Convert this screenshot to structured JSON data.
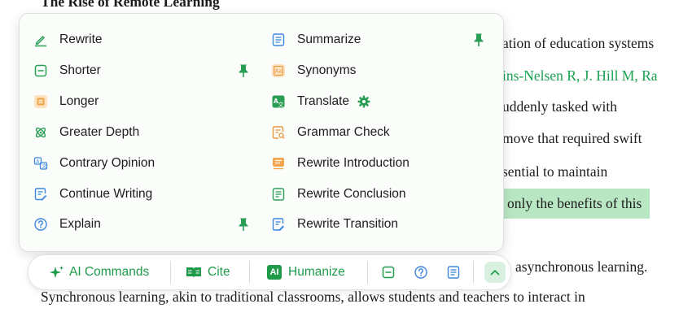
{
  "document": {
    "title": "The Rise of Remote Learning",
    "line1": "ation of education systems",
    "line2": "ins-Nelsen R, J. Hill M, Ra",
    "line3": "uddenly tasked with",
    "line4": "move that required swift",
    "line5": "sential to maintain",
    "line6": "only the benefits of this",
    "line7": "asynchronous learning.",
    "line8": "Synchronous learning, akin to traditional classrooms, allows students and teachers to interact in"
  },
  "menu": {
    "left": [
      {
        "label": "Rewrite",
        "icon": "pencil-icon",
        "pinned": false
      },
      {
        "label": "Shorter",
        "icon": "shorter-icon",
        "pinned": true
      },
      {
        "label": "Longer",
        "icon": "longer-icon",
        "pinned": false
      },
      {
        "label": "Greater Depth",
        "icon": "depth-icon",
        "pinned": false
      },
      {
        "label": "Contrary Opinion",
        "icon": "contrary-icon",
        "pinned": false
      },
      {
        "label": "Continue Writing",
        "icon": "continue-icon",
        "pinned": false
      },
      {
        "label": "Explain",
        "icon": "question-icon",
        "pinned": true
      }
    ],
    "right": [
      {
        "label": "Summarize",
        "icon": "summarize-icon",
        "pinned": true
      },
      {
        "label": "Synonyms",
        "icon": "synonyms-icon",
        "pinned": false
      },
      {
        "label": "Translate",
        "icon": "translate-icon",
        "pinned": false,
        "settings": true
      },
      {
        "label": "Grammar Check",
        "icon": "grammar-icon",
        "pinned": false
      },
      {
        "label": "Rewrite Introduction",
        "icon": "intro-icon",
        "pinned": false
      },
      {
        "label": "Rewrite Conclusion",
        "icon": "conclusion-icon",
        "pinned": false
      },
      {
        "label": "Rewrite Transition",
        "icon": "transition-icon",
        "pinned": false
      }
    ]
  },
  "toolbar": {
    "ai_commands": "AI Commands",
    "cite": "Cite",
    "humanize_badge": "AI",
    "humanize": "Humanize"
  },
  "colors": {
    "accent_green": "#1f9a4b",
    "icon_green": "#2a9d55",
    "icon_orange": "#e8963a",
    "icon_blue": "#3a86e0",
    "highlight_green": "#b9e6c3"
  }
}
